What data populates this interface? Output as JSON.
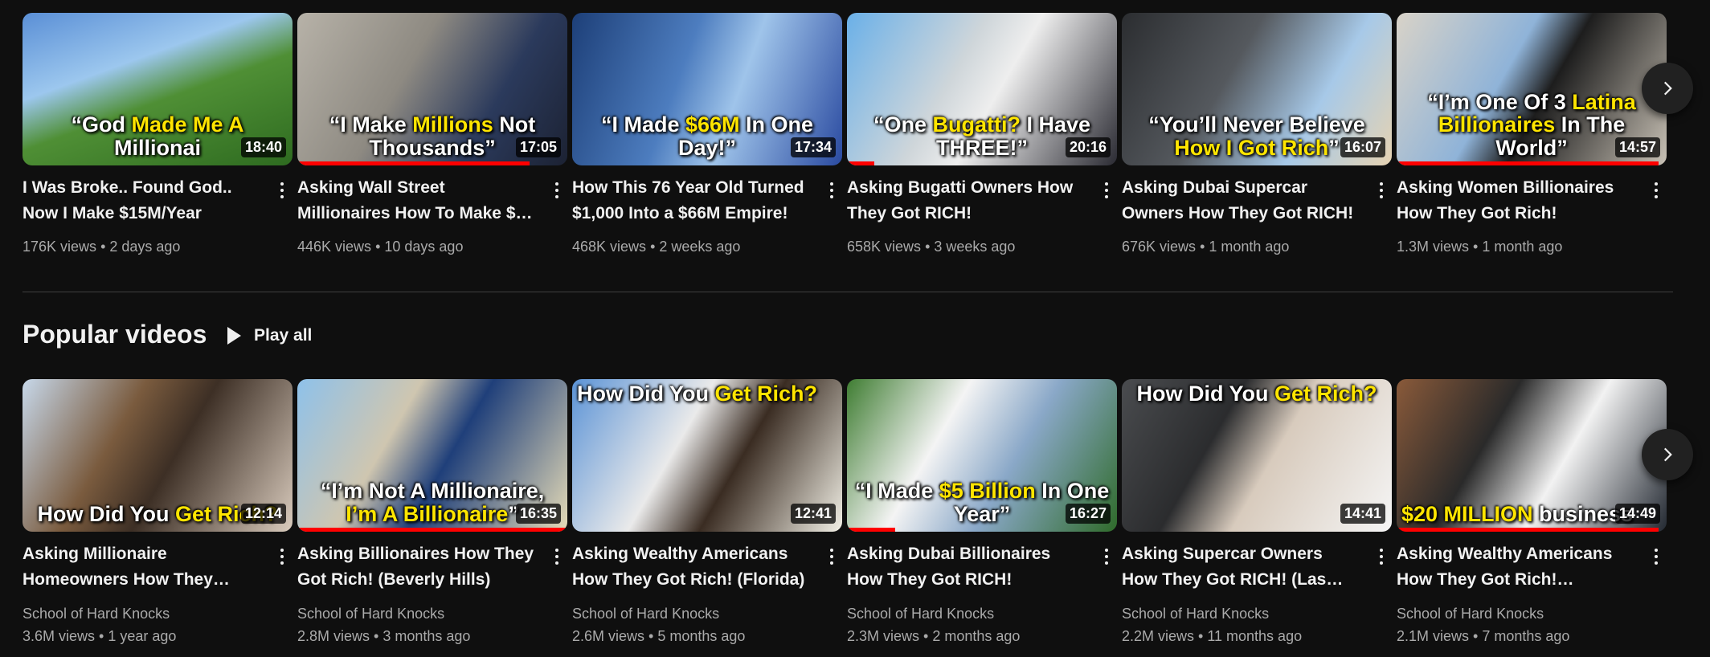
{
  "top_shelf": {
    "videos": [
      {
        "title": "I Was Broke.. Found God.. Now I Make $15M/Year",
        "views": "176K views",
        "age": "2 days ago",
        "duration": "18:40",
        "caption": [
          "“God ",
          "Made Me A ",
          "Millionai"
        ],
        "bg": "linear-gradient(160deg,#5a8fd6 0%,#9cc7ee 35%,#4f8f35 55%,#2e6b20 100%)",
        "watched": 0
      },
      {
        "title": "Asking Wall Street Millionaires How To Make $…",
        "views": "446K views",
        "age": "10 days ago",
        "duration": "17:05",
        "caption": [
          "“I Make ",
          "Millions",
          " Not Thousands”"
        ],
        "bg": "linear-gradient(120deg,#b7b2a8 0%,#8e8a82 40%,#2b3a5c 70%,#1c2233 100%)",
        "watched": 0.86
      },
      {
        "title": "How This 76 Year Old Turned $1,000 Into a $66M Empire!",
        "views": "468K views",
        "age": "2 weeks ago",
        "duration": "17:34",
        "caption": [
          "“I Made ",
          "$66M",
          " In One Day!”"
        ],
        "bg": "linear-gradient(110deg,#1d3f78 0%,#4d7dbf 40%,#9fc4ea 60%,#2a4aa0 100%)",
        "watched": 0
      },
      {
        "title": "Asking Bugatti Owners How They Got RICH!",
        "views": "658K views",
        "age": "3 weeks ago",
        "duration": "20:16",
        "caption": [
          "“One ",
          "Bugatti?",
          " I Have THREE!”"
        ],
        "bg": "linear-gradient(120deg,#6ab0e8 0%,#cfd6da 40%,#eeeeee 55%,#2a2a32 100%)",
        "watched": 0.1
      },
      {
        "title": "Asking Dubai Supercar Owners How They Got RICH!",
        "views": "676K views",
        "age": "1 month ago",
        "duration": "16:07",
        "caption": [
          "“You’ll Never Believe ",
          "How I Got Rich",
          "”"
        ],
        "bg": "linear-gradient(120deg,#2b2d30 0%,#55595e 40%,#a7c9e8 70%,#e6d3b2 100%)",
        "watched": 0
      },
      {
        "title": "Asking Women Billionaires How They Got Rich!",
        "views": "1.3M views",
        "age": "1 month ago",
        "duration": "14:57",
        "caption": [
          "“I’m One Of 3 ",
          "Latina Billionaires",
          " In The World”"
        ],
        "bg": "linear-gradient(120deg,#d9d3c8 0%,#8fb3d8 40%,#1d1d1d 55%,#c9c2b6 100%)",
        "watched": 0.97
      }
    ]
  },
  "bottom_shelf": {
    "section_title": "Popular videos",
    "play_all_label": "Play all",
    "videos": [
      {
        "title": "Asking Millionaire Homeowners How They Got…",
        "channel": "School of Hard Knocks",
        "views": "3.6M views",
        "age": "1 year ago",
        "duration": "12:14",
        "caption": [
          "How Did You ",
          "Get Rich?",
          ""
        ],
        "bg": "linear-gradient(120deg,#c7d8ea 0%,#7a5b3e 35%,#3d2f25 55%,#d9cbbd 100%)",
        "watched": 0
      },
      {
        "title": "Asking Billionaires How They Got Rich! (Beverly Hills)",
        "channel": "School of Hard Knocks",
        "views": "2.8M views",
        "age": "3 months ago",
        "duration": "16:35",
        "caption": [
          "“I’m Not A Millionaire, ",
          "I’m A Billionaire",
          "”"
        ],
        "bg": "linear-gradient(120deg,#8ec1ea 0%,#cfc6b0 35%,#1f3f7a 55%,#e6dcb8 100%)",
        "watched": 1
      },
      {
        "title": "Asking Wealthy Americans How They Got Rich! (Florida)",
        "channel": "School of Hard Knocks",
        "views": "2.6M views",
        "age": "5 months ago",
        "duration": "12:41",
        "caption": [
          "How Did You ",
          "Get Rich?",
          ""
        ],
        "top": true,
        "bg": "linear-gradient(120deg,#5b93d6 0%,#eaeaea 40%,#3a2c22 60%,#f2f0e6 100%)",
        "watched": 0
      },
      {
        "title": "Asking Dubai Billionaires How They Got RICH!",
        "channel": "School of Hard Knocks",
        "views": "2.3M views",
        "age": "2 months ago",
        "duration": "16:27",
        "caption": [
          "“I Made ",
          "$5 Billion",
          " In One Year”"
        ],
        "bg": "linear-gradient(120deg,#3f7d32 0%,#f4f4f4 35%,#8aa8c8 60%,#2f6b2a 100%)",
        "watched": 0.18
      },
      {
        "title": "Asking Supercar Owners How They Got RICH! (Las Vegas)",
        "channel": "School of Hard Knocks",
        "views": "2.2M views",
        "age": "11 months ago",
        "duration": "14:41",
        "caption": [
          "How Did You ",
          "Get Rich?",
          ""
        ],
        "top": true,
        "bg": "linear-gradient(120deg,#4a4c4f 0%,#2b2c2e 35%,#d8cbbd 55%,#f5f5f5 100%)",
        "watched": 0
      },
      {
        "title": "Asking Wealthy Americans How They Got Rich!…",
        "channel": "School of Hard Knocks",
        "views": "2.1M views",
        "age": "7 months ago",
        "duration": "14:49",
        "caption": [
          "",
          "$20 MILLION",
          " business"
        ],
        "bg": "linear-gradient(120deg,#8a5a3a 0%,#2a2a2a 35%,#f2f2f2 60%,#222831 100%)",
        "watched": 0.97
      }
    ]
  },
  "colors": {
    "background": "#0f0f0f",
    "progress": "#ff0000",
    "meta_text": "#aaaaaa",
    "caption_highlight": "#ffe500"
  },
  "icons": {
    "menu": "vertical-ellipsis-icon",
    "next": "chevron-right-icon",
    "play": "play-triangle-icon"
  }
}
